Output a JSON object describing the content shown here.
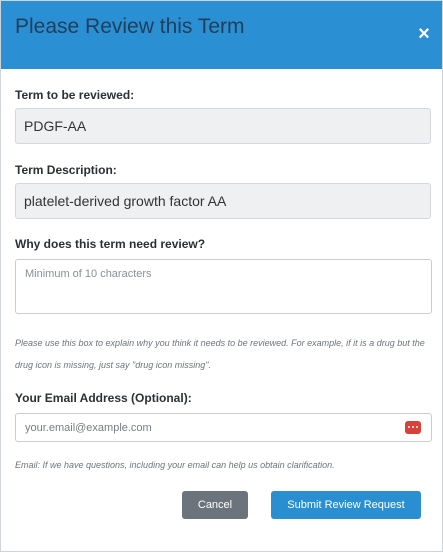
{
  "modal": {
    "title": "Please Review this Term",
    "close_label": "×"
  },
  "term": {
    "label": "Term to be reviewed:",
    "value": "PDGF-AA"
  },
  "description": {
    "label": "Term Description:",
    "value": "platelet-derived growth factor AA"
  },
  "reason": {
    "label": "Why does this term need review?",
    "placeholder": "Minimum of 10 characters",
    "help": "Please use this box to explain why you think it needs to be reviewed. For example, if it is a drug but the drug icon is missing, just say \"drug icon missing\"."
  },
  "email": {
    "label": "Your Email Address (Optional):",
    "placeholder": "your.email@example.com",
    "help": "Email: If we have questions, including your email can help us obtain clarification.",
    "icon": "password-manager-icon",
    "icon_color": "#d9403a"
  },
  "buttons": {
    "cancel": "Cancel",
    "submit": "Submit Review Request"
  },
  "colors": {
    "header": "#2b8fd4",
    "submit": "#2a8fd0",
    "cancel": "#6b747c"
  }
}
